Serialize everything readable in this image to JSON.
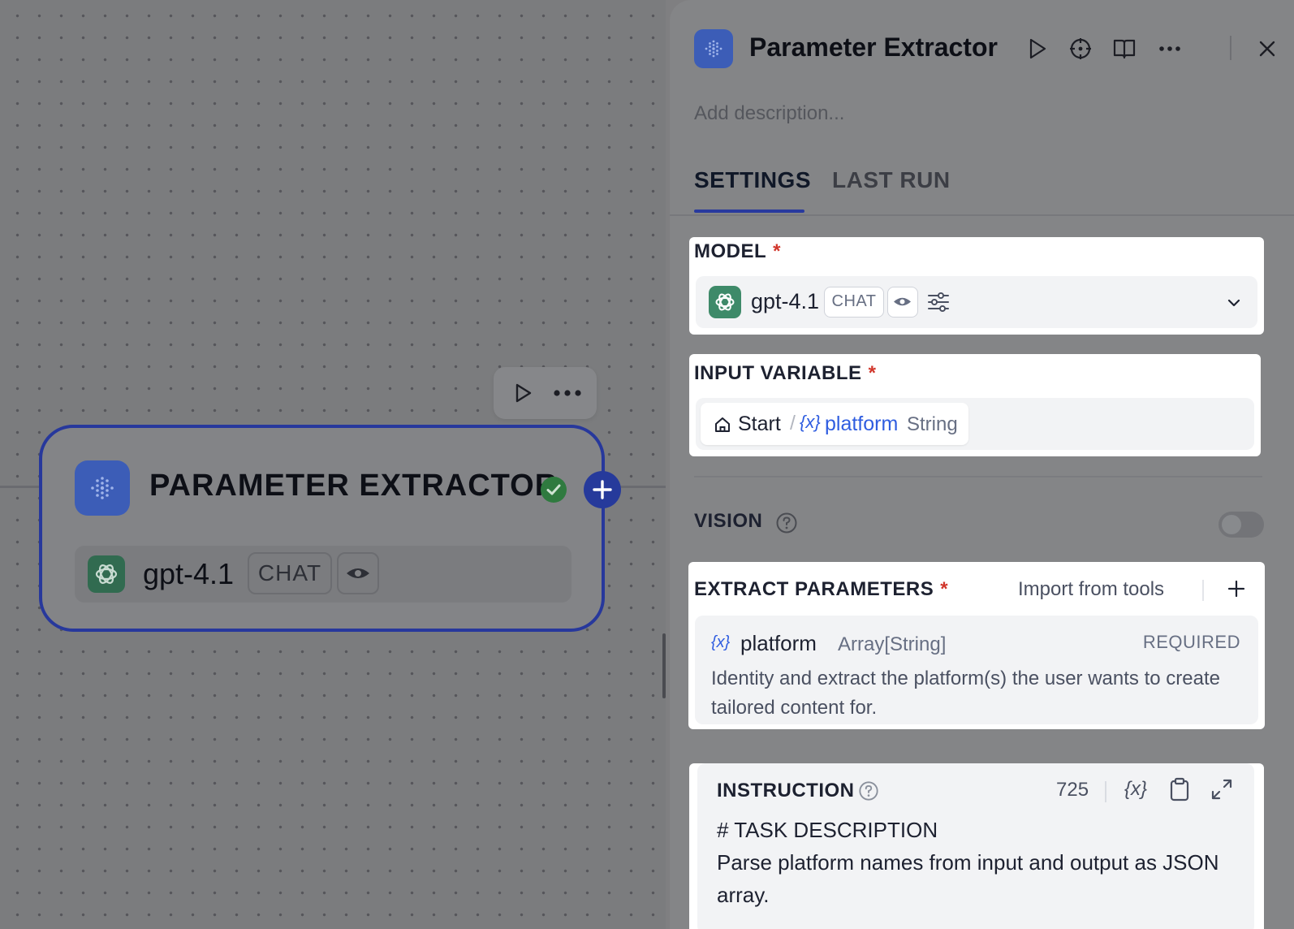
{
  "canvas": {
    "node": {
      "title": "PARAMETER EXTRACTOR",
      "model_name": "gpt-4.1",
      "model_mode": "CHAT",
      "status": "success"
    },
    "toolbar_icons": [
      "play-icon",
      "more-icon"
    ]
  },
  "panel": {
    "title": "Parameter Extractor",
    "description_placeholder": "Add description...",
    "header_actions": [
      "play-icon",
      "crosshair-icon",
      "book-icon",
      "more-icon",
      "close-icon"
    ],
    "tabs": [
      {
        "label": "SETTINGS",
        "active": true
      },
      {
        "label": "LAST RUN",
        "active": false
      }
    ],
    "model": {
      "label": "MODEL",
      "required_mark": "*",
      "name": "gpt-4.1",
      "mode": "CHAT"
    },
    "input_variable": {
      "label": "INPUT VARIABLE",
      "required_mark": "*",
      "source": "Start",
      "separator": "/",
      "var_icon": "{x}",
      "var_name": "platform",
      "var_type": "String"
    },
    "vision": {
      "label": "VISION",
      "enabled": false
    },
    "extract_parameters": {
      "label": "EXTRACT PARAMETERS",
      "required_mark": "*",
      "import_label": "Import from tools",
      "items": [
        {
          "icon": "{x}",
          "name": "platform",
          "type": "Array[String]",
          "required": "REQUIRED",
          "description": "Identity and extract the platform(s) the user wants to create tailored content for."
        }
      ]
    },
    "instruction": {
      "label": "INSTRUCTION",
      "char_count": "725",
      "var_icon": "{x}",
      "line1": "# TASK DESCRIPTION",
      "line2": "Parse platform names from input and output as JSON array."
    }
  },
  "colors": {
    "accent": "#28399e",
    "node_icon": "#3c5db7",
    "variable_blue": "#2f5de0",
    "required_red": "#d1362b",
    "success_green": "#2f7a3f",
    "openai_green": "#3e8a69"
  }
}
